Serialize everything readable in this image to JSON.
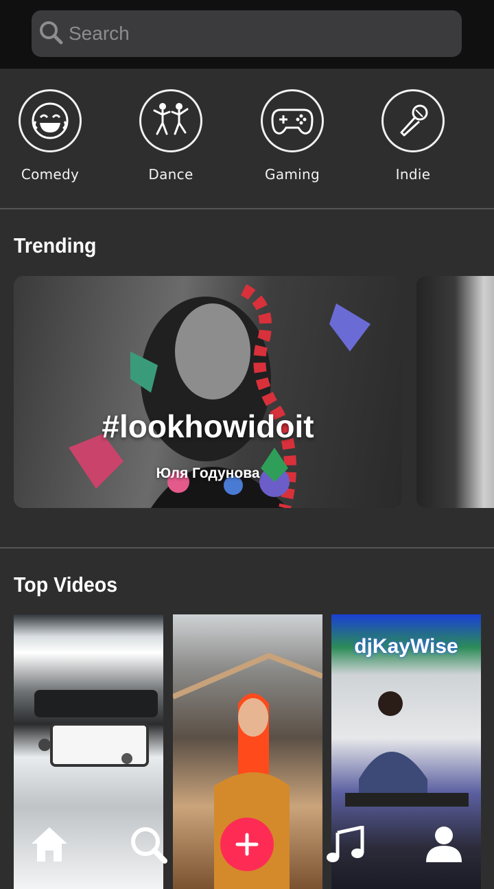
{
  "search": {
    "placeholder": "Search"
  },
  "categories": [
    {
      "label": "Comedy",
      "icon": "laughing-face-icon"
    },
    {
      "label": "Dance",
      "icon": "dancers-icon"
    },
    {
      "label": "Gaming",
      "icon": "gamepad-icon"
    },
    {
      "label": "Indie",
      "icon": "microphone-icon"
    }
  ],
  "trending": {
    "title": "Trending",
    "cards": [
      {
        "hashtag": "#lookhowidoit",
        "author": "Юля Годунова"
      }
    ]
  },
  "top_videos": {
    "title": "Top Videos",
    "items": [
      {
        "overlay_text": ""
      },
      {
        "overlay_text": ""
      },
      {
        "overlay_text": "djKayWise"
      }
    ]
  },
  "nav": {
    "items": [
      "home-icon",
      "search-icon",
      "plus-icon",
      "music-note-icon",
      "profile-icon"
    ],
    "active": "search-icon",
    "accent_color": "#fe2c55"
  }
}
